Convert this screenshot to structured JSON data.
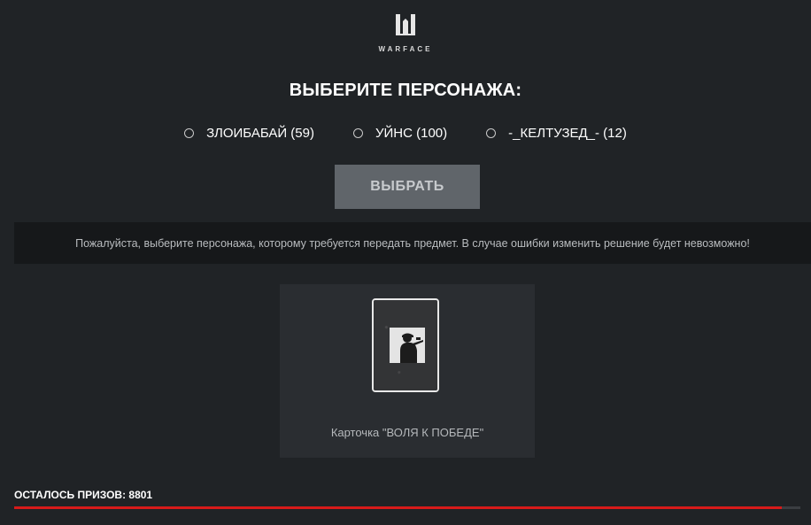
{
  "logo": {
    "text": "WARFACE"
  },
  "title": "ВЫБЕРИТЕ ПЕРСОНАЖА:",
  "characters": [
    {
      "label": "ЗЛОИБАБАЙ (59)",
      "selected": false
    },
    {
      "label": "УЙНС (100)",
      "selected": false
    },
    {
      "label": "-_КЕЛТУЗЕД_- (12)",
      "selected": false
    }
  ],
  "select_button": {
    "label": "ВЫБРАТЬ"
  },
  "notice": "Пожалуйста, выберите персонажа, которому требуется передать предмет. В случае ошибки изменить решение будет невозможно!",
  "reward": {
    "label": "Карточка \"ВОЛЯ К ПОБЕДЕ\""
  },
  "remaining": {
    "label": "ОСТАЛОСЬ ПРИЗОВ: 8801",
    "progress_fraction": 0.976
  },
  "colors": {
    "background": "#202326",
    "accent": "#d71a1a",
    "button": "#60656a"
  }
}
